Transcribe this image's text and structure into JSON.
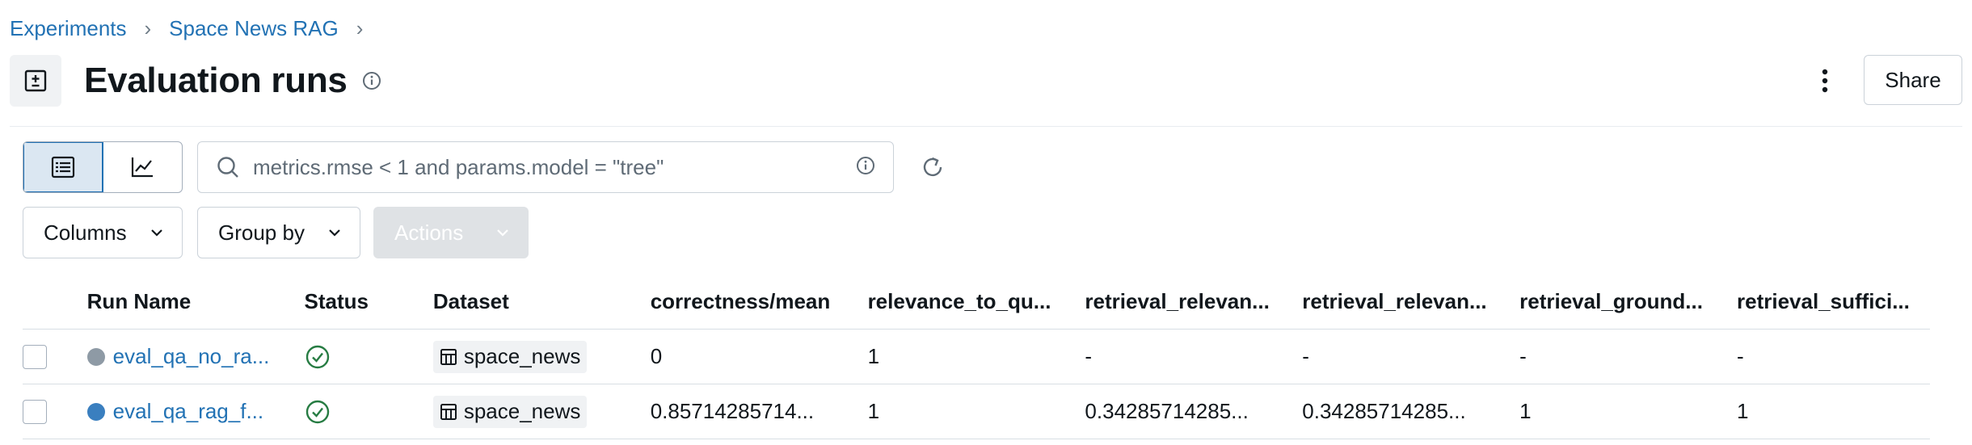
{
  "breadcrumb": {
    "items": [
      "Experiments",
      "Space News RAG"
    ],
    "separator": "›"
  },
  "header": {
    "title": "Evaluation runs",
    "share_label": "Share"
  },
  "toolbar": {
    "search_placeholder": "metrics.rmse < 1 and params.model = \"tree\"",
    "columns_label": "Columns",
    "group_by_label": "Group by",
    "actions_label": "Actions"
  },
  "table": {
    "headers": [
      "Run Name",
      "Status",
      "Dataset",
      "correctness/mean",
      "relevance_to_qu...",
      "retrieval_relevan...",
      "retrieval_relevan...",
      "retrieval_ground...",
      "retrieval_suffici..."
    ],
    "rows": [
      {
        "name": "eval_qa_no_ra...",
        "color": "#8e9aa5",
        "dataset": "space_news",
        "metrics": [
          "0",
          "1",
          "-",
          "-",
          "-",
          "-"
        ]
      },
      {
        "name": "eval_qa_rag_f...",
        "color": "#3a7fbf",
        "dataset": "space_news",
        "metrics": [
          "0.85714285714...",
          "1",
          "0.34285714285...",
          "0.34285714285...",
          "1",
          "1"
        ]
      }
    ]
  },
  "colors": {
    "link": "#2272b4",
    "success": "#277c43",
    "active_toggle_bg": "#dbe7f2"
  }
}
